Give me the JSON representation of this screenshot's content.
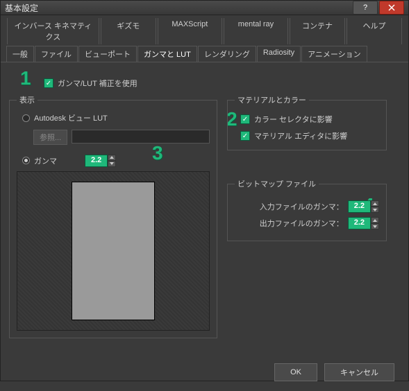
{
  "title": "基本設定",
  "menubar_row1": [
    "インバース キネマティクス",
    "ギズモ",
    "MAXScript",
    "mental ray",
    "コンテナ",
    "ヘルプ"
  ],
  "tabs": [
    "一般",
    "ファイル",
    "ビューポート",
    "ガンマと LUT",
    "レンダリング",
    "Radiosity",
    "アニメーション"
  ],
  "active_tab": "ガンマと LUT",
  "master_checkbox": "ガンマ/LUT 補正を使用",
  "groups": {
    "display": {
      "legend": "表示",
      "radio_lut": "Autodesk ビュー LUT",
      "browse": "参照...",
      "radio_gamma": "ガンマ",
      "gamma_value": "2.2"
    },
    "materials": {
      "legend": "マテリアルとカラー",
      "chk_color": "カラー セレクタに影響",
      "chk_mat": "マテリアル エディタに影響"
    },
    "bitmap": {
      "legend": "ビットマップ ファイル",
      "in_label": "入力ファイルのガンマ：",
      "out_label": "出力ファイルのガンマ：",
      "in_value": "2.2",
      "out_value": "2.2"
    }
  },
  "buttons": {
    "ok": "OK",
    "cancel": "キャンセル"
  },
  "annotations": {
    "a1": "1",
    "a2": "2",
    "a3": "3",
    "a4": "4"
  }
}
